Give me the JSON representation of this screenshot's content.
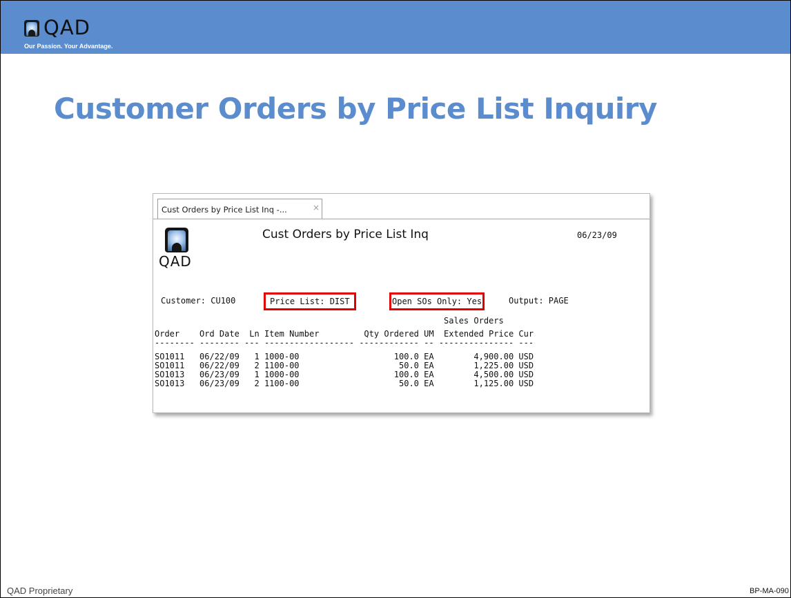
{
  "slide": {
    "brand": "QAD",
    "tagline": "Our Passion. Your Advantage.",
    "title": "Customer Orders by Price List Inquiry",
    "footer_left": "QAD Proprietary",
    "footer_right": "BP-MA-090"
  },
  "colors": {
    "band": "#5b8ccd",
    "title": "#5b8ccd",
    "highlight": "#e00000"
  },
  "window": {
    "tab_label": "Cust Orders by Price List Inq -...",
    "tab_close_icon": "×",
    "emblem_text": "QAD",
    "report_title": "Cust Orders by Price List Inq",
    "date": "06/23/09",
    "params": {
      "customer": "Customer: CU100",
      "price_list": "Price List: DIST",
      "open_sos": "Open SOs Only: Yes",
      "output": "Output: PAGE"
    },
    "header_group": "Sales Orders",
    "columns": [
      "Order",
      "Ord Date",
      "Ln",
      "Item Number",
      "Qty Ordered",
      "UM",
      "Extended Price",
      "Cur"
    ],
    "rows": [
      [
        "SO1011",
        "06/22/09",
        "1",
        "1000-00",
        "100.0",
        "EA",
        "4,900.00",
        "USD"
      ],
      [
        "SO1011",
        "06/22/09",
        "2",
        "1100-00",
        "50.0",
        "EA",
        "1,225.00",
        "USD"
      ],
      [
        "SO1013",
        "06/23/09",
        "1",
        "1000-00",
        "100.0",
        "EA",
        "4,500.00",
        "USD"
      ],
      [
        "SO1013",
        "06/23/09",
        "2",
        "1100-00",
        "50.0",
        "EA",
        "1,125.00",
        "USD"
      ]
    ]
  }
}
